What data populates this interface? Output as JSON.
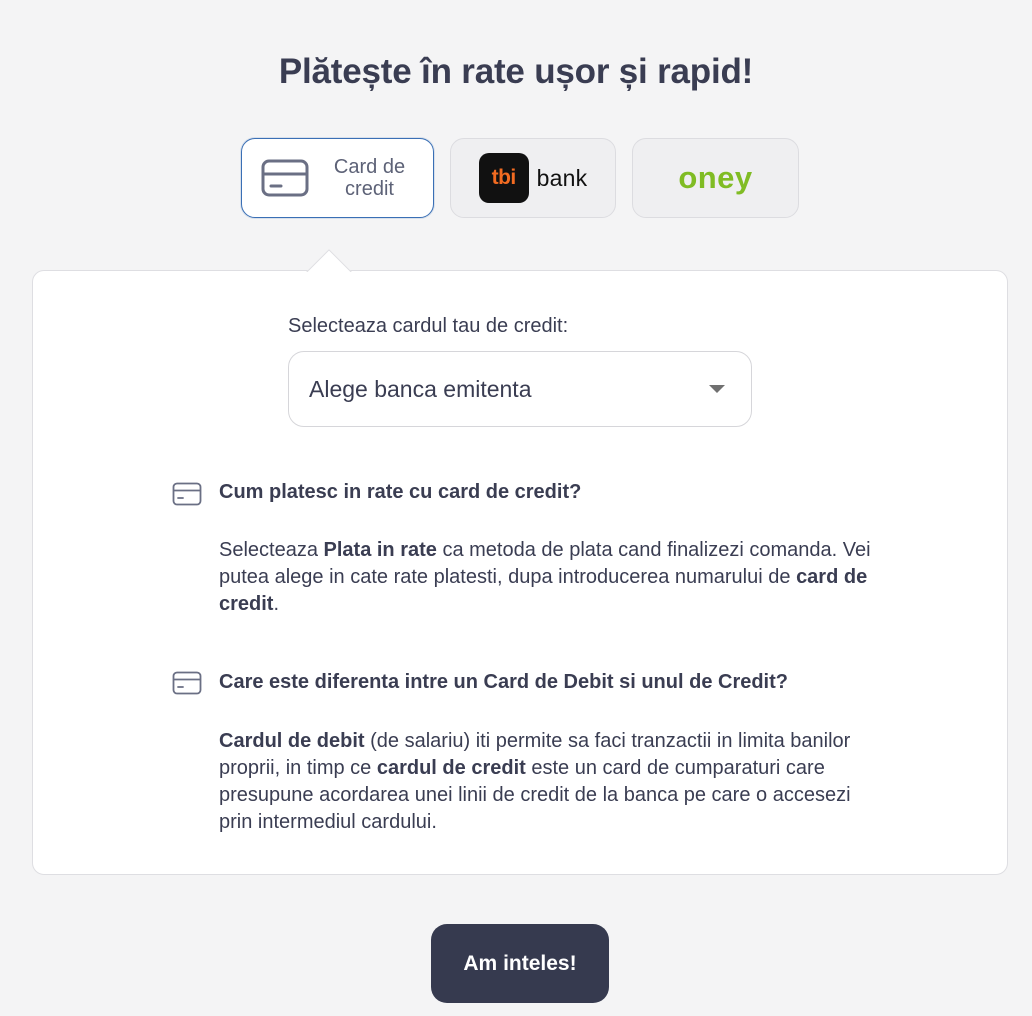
{
  "title": "Plătește în rate ușor și rapid!",
  "tabs": {
    "card": {
      "label": "Card de credit",
      "icon": "credit-card-icon",
      "active": true
    },
    "tbi": {
      "logo_text": "tbi",
      "label": "bank"
    },
    "oney": {
      "label": "oney"
    }
  },
  "select": {
    "label": "Selecteaza cardul tau de credit:",
    "value": "Alege banca emitenta"
  },
  "faq": [
    {
      "icon": "credit-card-icon",
      "question": "Cum platesc in rate cu card de credit?",
      "answer": {
        "p1": "Selecteaza ",
        "b1": "Plata in rate",
        "p2": " ca metoda de plata cand finalizezi comanda. Vei putea alege in cate rate platesti, dupa introducerea numarului de ",
        "b2": "card de credit",
        "p3": "."
      }
    },
    {
      "icon": "credit-card-icon",
      "question": "Care este diferenta intre un Card de Debit si unul de Credit?",
      "answer": {
        "b1": "Cardul de debit",
        "p1": " (de salariu) iti permite sa faci tranzactii in limita banilor proprii, in timp ce ",
        "b2": "cardul de credit",
        "p2": " este un card de cumparaturi care presupune acordarea unei linii de credit de la banca pe care o accesezi prin intermediul cardului."
      }
    }
  ],
  "button": {
    "label": "Am inteles!"
  },
  "colors": {
    "background": "#f4f4f5",
    "text": "#3a3d52",
    "active_border": "#3a6fb5",
    "button": "#363a4f",
    "tbi_orange": "#f26b21",
    "oney_green": "#80bc24"
  }
}
